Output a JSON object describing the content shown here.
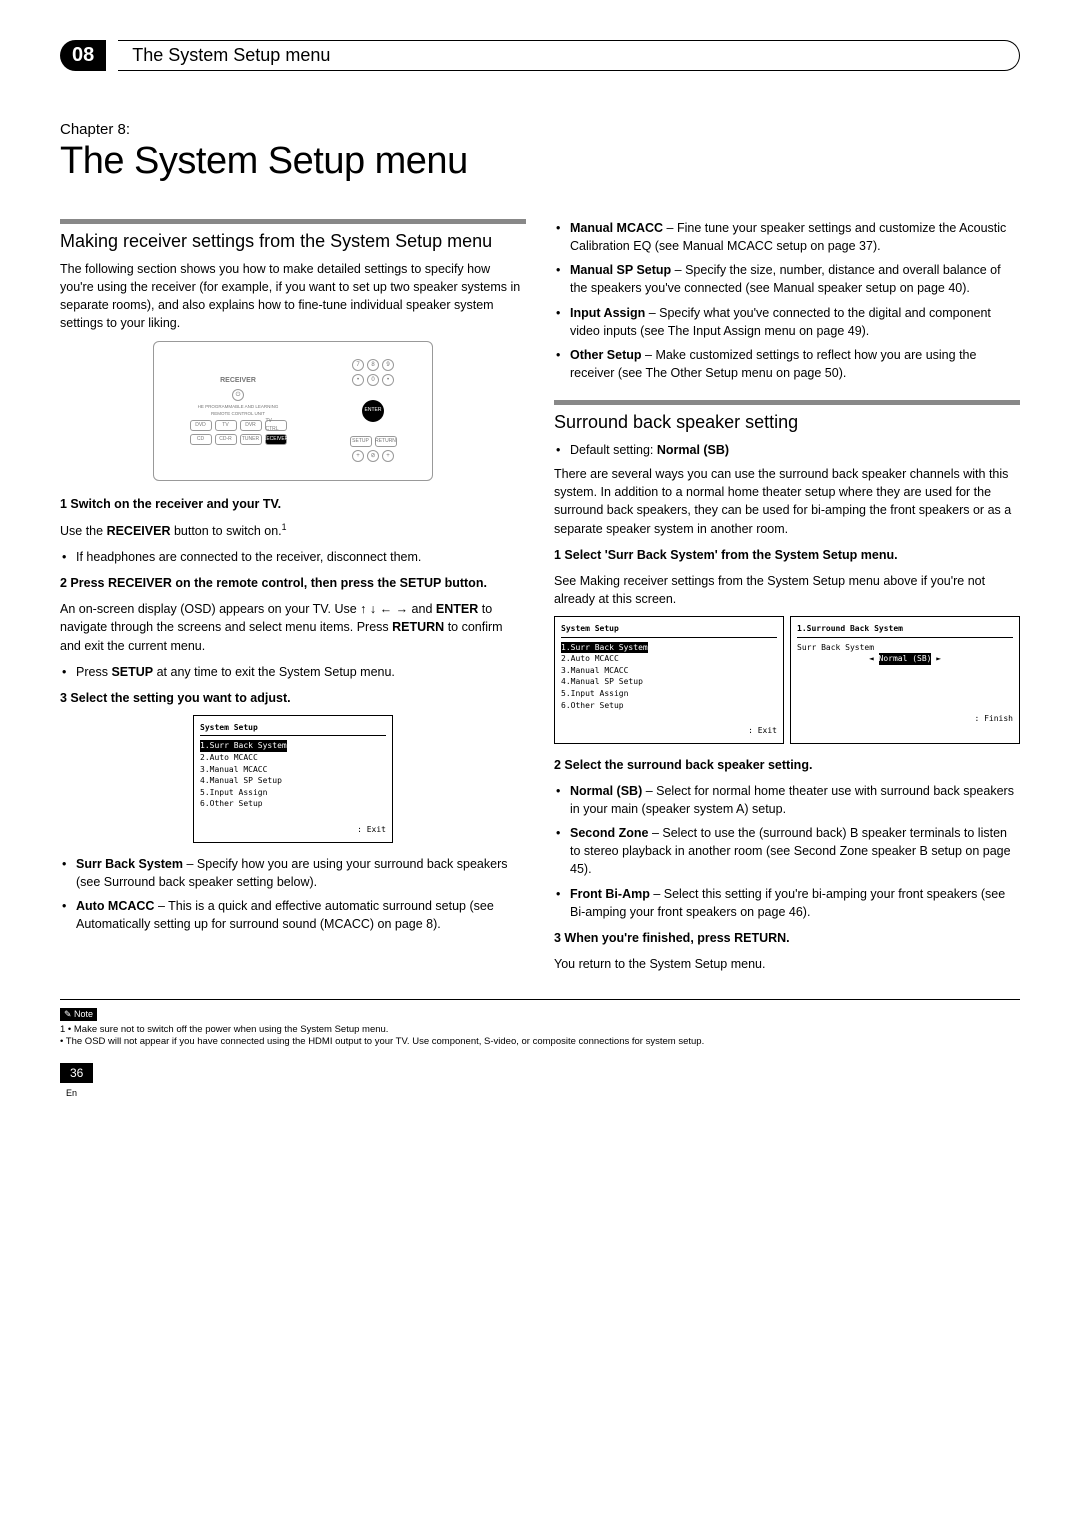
{
  "header": {
    "chapter_num": "08",
    "header_title": "The System Setup menu"
  },
  "chapter": {
    "label": "Chapter 8:",
    "title": "The System Setup menu"
  },
  "left": {
    "section1_head": "Making receiver settings from the System Setup menu",
    "intro": "The following section shows you how to make detailed settings to specify how you're using the receiver (for example, if you want to set up two speaker systems in separate rooms), and also explains how to fine-tune individual speaker system settings to your liking.",
    "step1": "1   Switch on the receiver and your TV.",
    "step1_body_a": "Use the ",
    "step1_body_b": "RECEIVER",
    "step1_body_c": " button to switch on.",
    "step1_bullet": "If headphones are connected to the receiver, disconnect them.",
    "step2": "2   Press RECEIVER on the remote control, then press the SETUP button.",
    "step2_body_a": "An on-screen display (OSD) appears on your TV. Use ",
    "step2_body_b": " and ",
    "step2_enter": "ENTER",
    "step2_body_c": " to navigate through the screens and select menu items. Press ",
    "step2_return": "RETURN",
    "step2_body_d": " to confirm and exit the current menu.",
    "step2_bullet_a": "Press ",
    "step2_bullet_b": "SETUP",
    "step2_bullet_c": " at any time to exit the System Setup menu.",
    "step3": "3   Select the setting you want to adjust.",
    "osd1": {
      "title": "System  Setup",
      "items": [
        "1.Surr  Back  System",
        "2.Auto  MCACC",
        "3.Manual  MCACC",
        "4.Manual  SP  Setup",
        "5.Input  Assign",
        "6.Other  Setup"
      ],
      "exit": ": Exit"
    },
    "b_surr_a": "Surr Back System",
    "b_surr_b": " – Specify how you are using your surround back speakers (see ",
    "b_surr_c": "Surround back speaker setting",
    "b_surr_d": " below).",
    "b_auto_a": "Auto MCACC",
    "b_auto_b": " – This is a quick and effective automatic surround setup (see ",
    "b_auto_c": "Automatically setting up for surround sound (MCACC)",
    "b_auto_d": " on page 8)."
  },
  "right": {
    "b_man_a": "Manual MCACC",
    "b_man_b": " – Fine tune your speaker settings and customize the Acoustic Calibration EQ (see ",
    "b_man_c": "Manual MCACC setup",
    "b_man_d": " on page 37).",
    "b_sp_a": "Manual SP Setup",
    "b_sp_b": " – Specify the size, number, distance and overall balance of the speakers you've connected (see ",
    "b_sp_c": "Manual speaker setup",
    "b_sp_d": " on page 40).",
    "b_in_a": "Input Assign",
    "b_in_b": " – Specify what you've connected to the digital and component video inputs (see ",
    "b_in_c": "The Input Assign menu",
    "b_in_d": " on page 49).",
    "b_oth_a": "Other Setup",
    "b_oth_b": " – Make customized settings to reflect how you are using the receiver (see ",
    "b_oth_c": "The Other Setup menu",
    "b_oth_d": " on page 50).",
    "section2_head": "Surround back speaker setting",
    "default_a": "Default setting: ",
    "default_b": "Normal (SB)",
    "para": "There are several ways you can use the surround back speaker channels with this system. In addition to a normal home theater setup where they are used for the surround back speakers, they can be used for bi-amping the front speakers or as a separate speaker system in another room.",
    "rstep1": "1   Select 'Surr Back System' from the System Setup menu.",
    "rstep1_body_a": "See ",
    "rstep1_body_b": "Making receiver settings from the System Setup menu",
    "rstep1_body_c": " above if you're not already at this screen.",
    "osd2a": {
      "title": "System  Setup",
      "items": [
        "1.Surr  Back  System",
        "2.Auto  MCACC",
        "3.Manual  MCACC",
        "4.Manual  SP  Setup",
        "5.Input  Assign",
        "6.Other  Setup"
      ],
      "exit": ": Exit"
    },
    "osd2b": {
      "title": "1.Surround  Back  System",
      "label": "Surr Back System",
      "value": "Normal (SB)",
      "exit": ": Finish"
    },
    "rstep2": "2   Select the surround back speaker setting.",
    "rb_norm_a": "Normal (SB)",
    "rb_norm_b": " – Select for normal home theater use with surround back speakers in your main (speaker system A) setup.",
    "rb_sz_a": "Second Zone",
    "rb_sz_b": " – Select to use the (surround back) B speaker terminals to listen to stereo playback in another room (see ",
    "rb_sz_c": "Second Zone speaker B setup",
    "rb_sz_d": " on page 45).",
    "rb_bi_a": "Front Bi-Amp",
    "rb_bi_b": " – Select this setting if you're bi-amping your front speakers (see ",
    "rb_bi_c": "Bi-amping your front speakers",
    "rb_bi_d": " on page 46).",
    "rstep3": "3   When you're finished, press RETURN.",
    "rstep3_body": "You return to the System Setup menu."
  },
  "footer": {
    "note_label": "Note",
    "fn1": "1 • Make sure not to switch off the power when using the System Setup menu.",
    "fn2": "   • The OSD will not appear if you have connected using the HDMI output to your TV. Use component, S-video, or composite connections for system setup.",
    "page_num": "36",
    "lang": "En"
  },
  "remote": {
    "receiver": "RECEIVER",
    "enter": "ENTER",
    "btns": [
      "DVD",
      "TV",
      "DVR",
      "TV CTRL",
      "CD",
      "CD-R",
      "TUNER"
    ],
    "nums": [
      "7",
      "8",
      "9",
      "•",
      "0",
      "•"
    ]
  }
}
